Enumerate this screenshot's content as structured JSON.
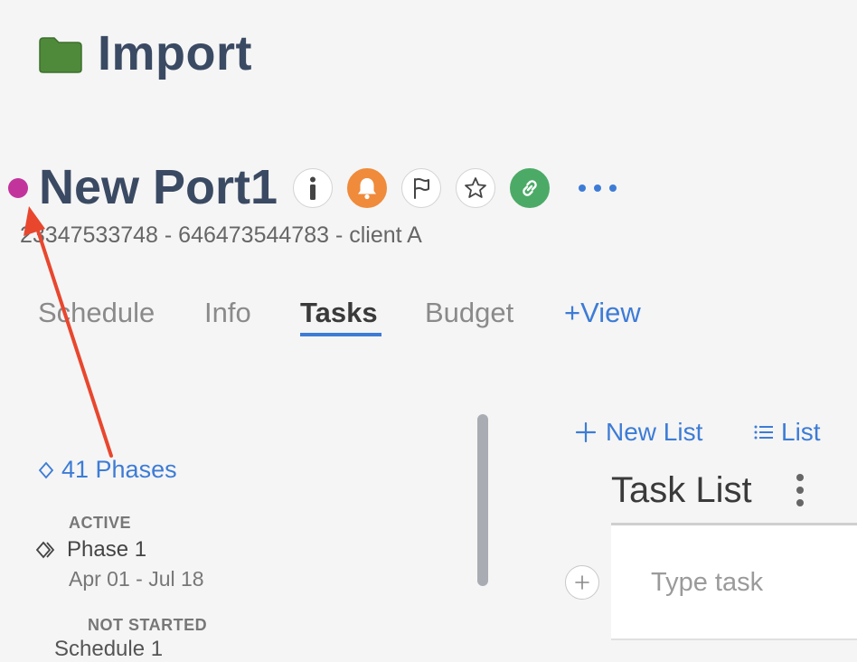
{
  "folder": {
    "title": "Import",
    "icon": "folder-icon",
    "color": "#4f8a3a"
  },
  "project": {
    "title": "New Port1",
    "subtitle": "23347533748 - 646473544783 - client A",
    "status_color": "#c2349c",
    "actions": [
      {
        "name": "info-icon"
      },
      {
        "name": "bell-icon",
        "color": "#ef8b3b"
      },
      {
        "name": "flag-icon"
      },
      {
        "name": "star-icon"
      },
      {
        "name": "link-icon",
        "color": "#4caa67"
      },
      {
        "name": "more-icon"
      }
    ]
  },
  "tabs": [
    {
      "label": "Schedule"
    },
    {
      "label": "Info"
    },
    {
      "label": "Tasks",
      "active": true
    },
    {
      "label": "Budget"
    },
    {
      "label": "+View"
    }
  ],
  "phases": {
    "link_label": "41 Phases",
    "groups": [
      {
        "status": "ACTIVE",
        "items": [
          {
            "name": "Phase 1",
            "dates": "Apr 01 - Jul 18"
          }
        ]
      },
      {
        "status": "NOT STARTED",
        "items": [
          {
            "name": "Schedule 1"
          }
        ]
      }
    ]
  },
  "task_panel": {
    "new_list_label": "New List",
    "list_view_label": "List",
    "list_title": "Task List",
    "task_placeholder": "Type task"
  },
  "colors": {
    "accent": "#3d7cd6",
    "annotation_arrow": "#e8472e"
  }
}
